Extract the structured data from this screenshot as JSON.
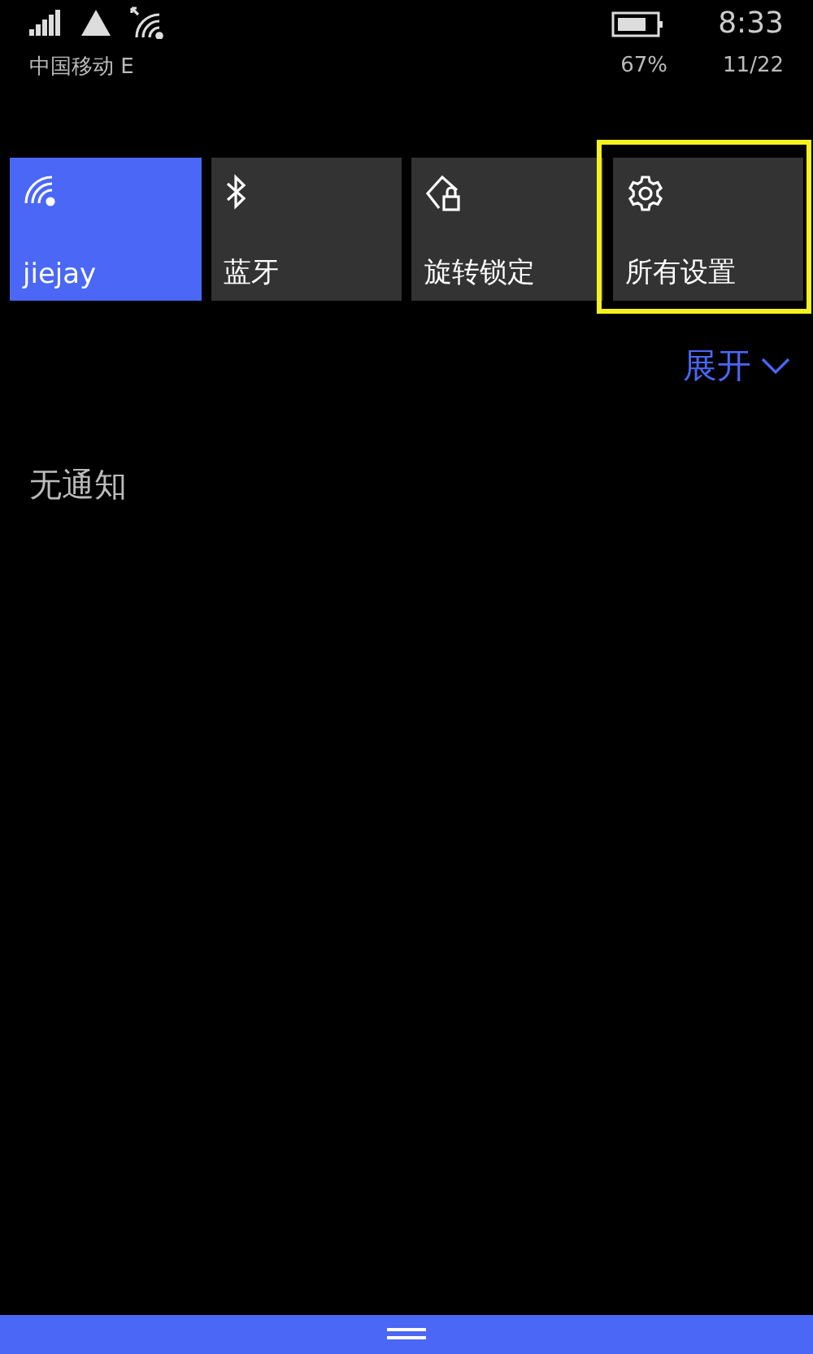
{
  "status_bar": {
    "carrier": "中国移动 E",
    "battery_percent": "67%",
    "time": "8:33",
    "date": "11/22"
  },
  "quick_actions": [
    {
      "label": "jiejay",
      "kind": "wifi",
      "on": true,
      "highlighted": false
    },
    {
      "label": "蓝牙",
      "kind": "bluetooth",
      "on": false,
      "highlighted": false
    },
    {
      "label": "旋转锁定",
      "kind": "rotation-lock",
      "on": false,
      "highlighted": false
    },
    {
      "label": "所有设置",
      "kind": "settings",
      "on": false,
      "highlighted": true
    }
  ],
  "expand_button": {
    "label": "展开"
  },
  "notifications": {
    "empty_text": "无通知"
  }
}
